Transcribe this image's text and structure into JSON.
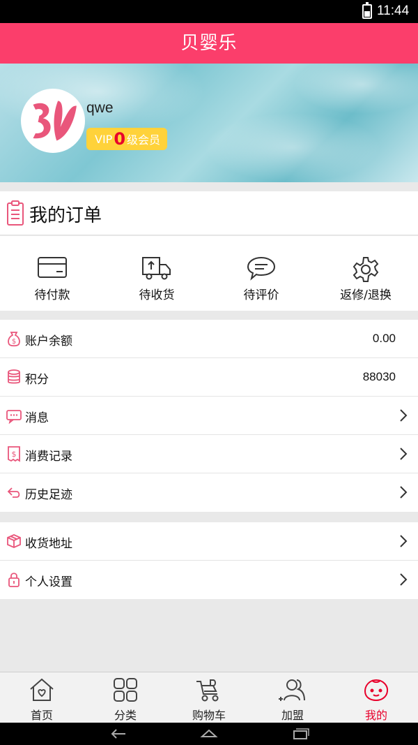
{
  "status_bar": {
    "time": "11:44"
  },
  "app": {
    "title": "贝婴乐"
  },
  "profile": {
    "username": "qwe",
    "vip_prefix": "VIP",
    "vip_level": "0",
    "vip_suffix": "级会员"
  },
  "orders": {
    "title": "我的订单",
    "items": [
      {
        "label": "待付款",
        "icon": "card-icon"
      },
      {
        "label": "待收货",
        "icon": "truck-icon"
      },
      {
        "label": "待评价",
        "icon": "comment-icon"
      },
      {
        "label": "返修/退换",
        "icon": "gear-icon"
      }
    ]
  },
  "account_list": [
    {
      "label": "账户余额",
      "value": "0.00",
      "icon": "money-bag-icon"
    },
    {
      "label": "积分",
      "value": "88030",
      "icon": "coins-icon"
    },
    {
      "label": "消息",
      "icon": "message-icon"
    },
    {
      "label": "消费记录",
      "icon": "receipt-icon"
    },
    {
      "label": "历史足迹",
      "icon": "history-icon"
    }
  ],
  "settings_list": [
    {
      "label": "收货地址",
      "icon": "package-icon"
    },
    {
      "label": "个人设置",
      "icon": "lock-icon"
    }
  ],
  "tabs": [
    {
      "label": "首页",
      "icon": "home-icon"
    },
    {
      "label": "分类",
      "icon": "grid-icon"
    },
    {
      "label": "购物车",
      "icon": "cart-icon"
    },
    {
      "label": "加盟",
      "icon": "add-user-icon"
    },
    {
      "label": "我的",
      "icon": "me-icon",
      "active": true
    }
  ],
  "colors": {
    "brand": "#fb3e6b",
    "vip_badge": "#ffd23a",
    "active_tab": "#e8002b"
  }
}
